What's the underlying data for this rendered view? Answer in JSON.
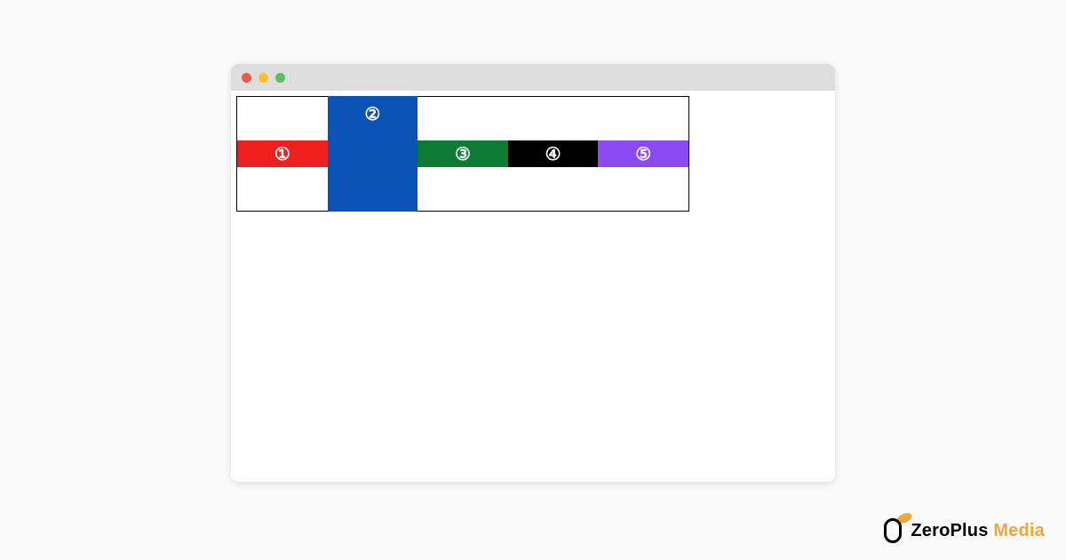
{
  "window": {
    "traffic_lights": [
      "close",
      "minimize",
      "zoom"
    ]
  },
  "boxes": [
    {
      "label": "①",
      "color": "#ef1f1f",
      "size": "small"
    },
    {
      "label": "②",
      "color": "#0b52b6",
      "size": "big"
    },
    {
      "label": "③",
      "color": "#0d7b33",
      "size": "small"
    },
    {
      "label": "④",
      "color": "#000000",
      "size": "small"
    },
    {
      "label": "⑤",
      "color": "#8c4af2",
      "size": "small"
    }
  ],
  "logo": {
    "brand": "ZeroPlus",
    "suffix": "Media"
  }
}
